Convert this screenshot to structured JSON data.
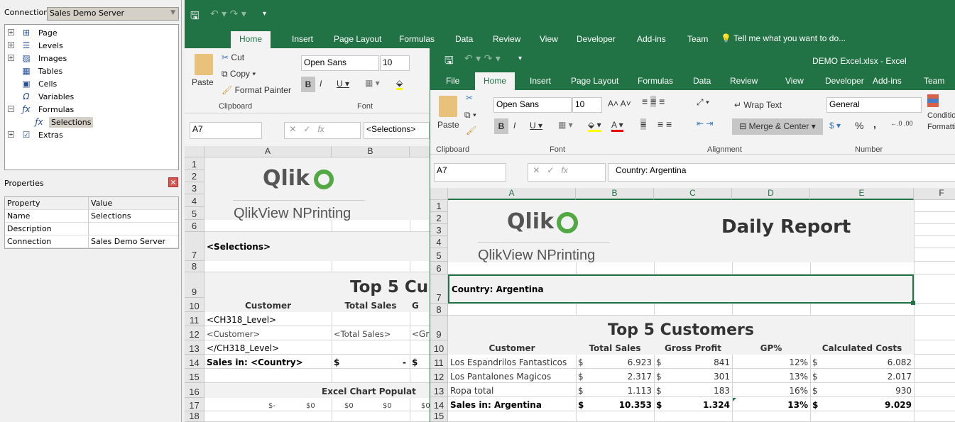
{
  "left_panel": {
    "connection_label": "Connection",
    "connection_value": "Sales Demo Server",
    "tree": [
      {
        "label": "Page",
        "icon": "page-icon",
        "expander": "+"
      },
      {
        "label": "Levels",
        "icon": "levels-icon",
        "expander": "+"
      },
      {
        "label": "Images",
        "icon": "images-icon",
        "expander": "+"
      },
      {
        "label": "Tables",
        "icon": "tables-icon",
        "expander": ""
      },
      {
        "label": "Cells",
        "icon": "cells-icon",
        "expander": ""
      },
      {
        "label": "Variables",
        "icon": "omega-icon",
        "expander": ""
      },
      {
        "label": "Formulas",
        "icon": "fx-icon",
        "expander": "-"
      },
      {
        "label": "Selections",
        "icon": "fx-icon",
        "expander": "",
        "child": true,
        "selected": true
      },
      {
        "label": "Extras",
        "icon": "extras-icon",
        "expander": "+"
      }
    ],
    "properties_title": "Properties",
    "properties_header": [
      "Property",
      "Value"
    ],
    "properties": [
      [
        "Name",
        "Selections"
      ],
      [
        "Description",
        ""
      ],
      [
        "Connection",
        "Sales Demo Server"
      ]
    ]
  },
  "back_excel": {
    "tabs": [
      "Home",
      "Insert",
      "Page Layout",
      "Formulas",
      "Data",
      "Review",
      "View",
      "Developer",
      "Add-ins",
      "Team"
    ],
    "tell_me": "Tell me what you want to do...",
    "clipboard": {
      "paste": "Paste",
      "cut": "Cut",
      "copy": "Copy",
      "format_painter": "Format Painter",
      "group": "Clipboard"
    },
    "font": {
      "name": "Open Sans",
      "size": "10",
      "group": "Font"
    },
    "name_box": "A7",
    "formula": "<Selections>",
    "columns": [
      "A",
      "B"
    ],
    "rows": [
      "1",
      "2",
      "3",
      "4",
      "5",
      "6",
      "7",
      "8",
      "9",
      "10",
      "11",
      "12",
      "13",
      "14",
      "15",
      "16",
      "17",
      "18"
    ],
    "logo_top": "Qlik",
    "logo_bottom": "QlikView NPrinting",
    "selections": "<Selections>",
    "title": "Top 5 Cu",
    "headers": [
      "Customer",
      "Total Sales",
      "G"
    ],
    "r11": "<CH318_Level>",
    "r12": [
      "<Customer>",
      "<Total Sales>",
      "<Gr"
    ],
    "r13": "</CH318_Level>",
    "r14": [
      "Sales in: <Country>",
      "$",
      "-",
      "$"
    ],
    "r16": "Excel Chart Populat",
    "r17": [
      "$-",
      "$0",
      "$0",
      "$0",
      "$0"
    ]
  },
  "front_excel": {
    "title": "DEMO Excel.xlsx - Excel",
    "tabs": [
      "File",
      "Home",
      "Insert",
      "Page Layout",
      "Formulas",
      "Data",
      "Review",
      "View",
      "Developer",
      "Add-ins",
      "Team"
    ],
    "font": {
      "name": "Open Sans",
      "size": "10",
      "group": "Font"
    },
    "clipboard": {
      "paste": "Paste",
      "group": "Clipboard"
    },
    "alignment": {
      "wrap": "Wrap Text",
      "merge": "Merge & Center",
      "group": "Alignment"
    },
    "number": {
      "format": "General",
      "percent": "%",
      "comma": ",",
      "group": "Number"
    },
    "conditional": "Conditional Formatting",
    "name_box": "A7",
    "formula": "Country: Argentina",
    "columns": [
      "A",
      "B",
      "C",
      "D",
      "E",
      "F"
    ],
    "rows": [
      "1",
      "2",
      "3",
      "4",
      "5",
      "6",
      "7",
      "8",
      "9",
      "10",
      "11",
      "12",
      "13",
      "14",
      "15"
    ],
    "logo_top": "Qlik",
    "logo_bottom": "QlikView NPrinting",
    "report_title": "Daily Report",
    "country": "Country: Argentina",
    "table_title": "Top 5 Customers",
    "headers": [
      "Customer",
      "Total Sales",
      "Gross Profit",
      "GP%",
      "Calculated Costs"
    ],
    "data": [
      [
        "Los Espandrilos Fantasticos",
        "6.923",
        "841",
        "12%",
        "6.082"
      ],
      [
        "Los Pantalones Magicos",
        "2.317",
        "301",
        "13%",
        "2.017"
      ],
      [
        "Ropa total",
        "1.113",
        "183",
        "16%",
        "930"
      ]
    ],
    "total": [
      "Sales in: Argentina",
      "10.353",
      "1.324",
      "13%",
      "9.029"
    ],
    "currency": "$",
    "accent": "#217346"
  }
}
